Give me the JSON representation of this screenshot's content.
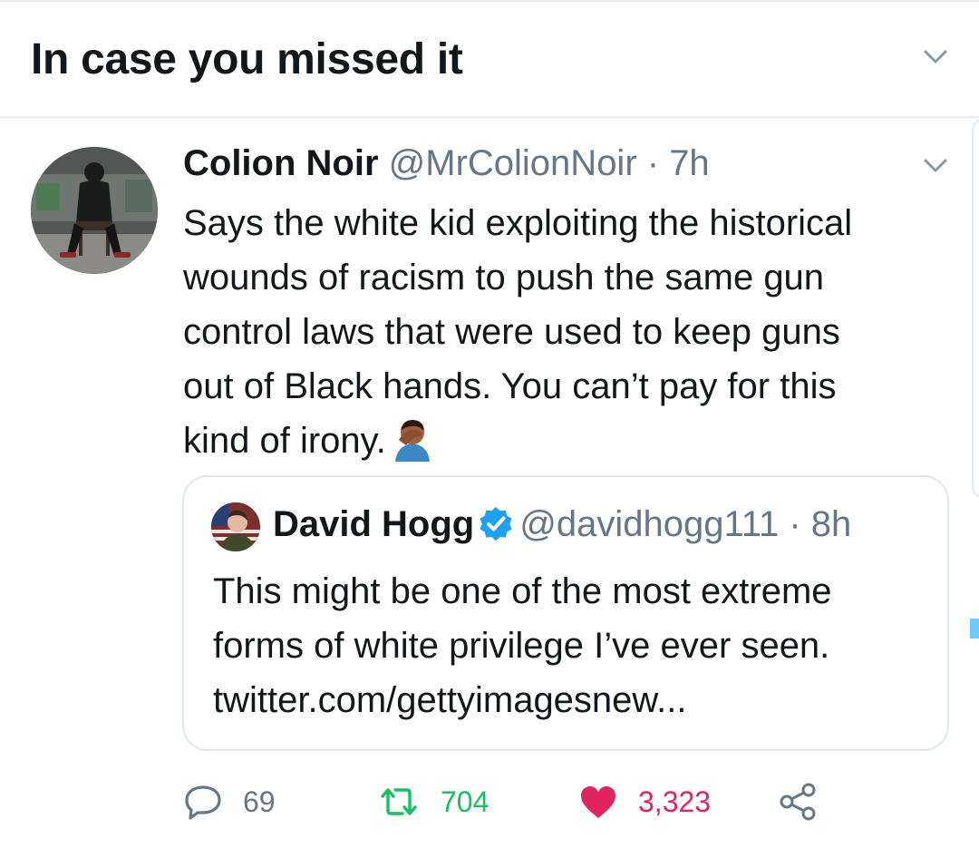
{
  "header": {
    "title": "In case you missed it",
    "caret_icon": "chevron-down-icon"
  },
  "tweet": {
    "author_name": "Colion Noir",
    "author_meta": "@MrColionNoir · 7h",
    "text": "Says the white kid exploiting the historical\nwounds of racism to push the same gun\ncontrol laws  that were used to keep guns\nout of Black hands. You can’t pay for this\nkind of irony.",
    "emoji_icon": "facepalm-emoji-icon",
    "caret_icon": "chevron-down-icon"
  },
  "quoted_tweet": {
    "author_name": "David Hogg",
    "verified_icon": "verified-badge-icon",
    "author_meta": "@davidhogg111 · 8h",
    "text": "This might be one of the most extreme\nforms of white privilege I’ve ever seen.\ntwitter.com/gettyimagesnew..."
  },
  "actions": {
    "reply_count": "69",
    "retweet_count": "704",
    "like_count": "3,323",
    "reply_icon": "reply-bubble-icon",
    "retweet_icon": "retweet-icon",
    "like_icon": "heart-icon",
    "share_icon": "share-icon"
  },
  "colors": {
    "text": "#14171a",
    "muted": "#657786",
    "retweet": "#17bf63",
    "like": "#e0245e",
    "verified": "#1da1f2",
    "border": "#e1e8ed"
  }
}
